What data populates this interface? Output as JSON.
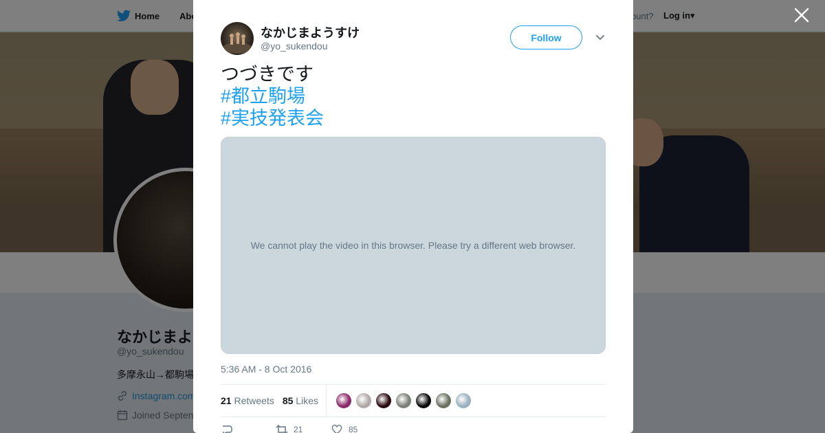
{
  "nav": {
    "home_label": "Home",
    "about_label": "Abo",
    "account_text": "ccount?",
    "login_label": "Log in"
  },
  "profile": {
    "name": "なかじまよ",
    "handle": "@yo_sukendou",
    "bio": "多摩永山→都駒場",
    "link_text": "Instagram.com",
    "joined_text": "Joined Septen"
  },
  "tweet": {
    "author_name": "なかじまようすけ",
    "author_handle": "@yo_sukendou",
    "follow_label": "Follow",
    "text": "つづきです",
    "hashtags": [
      "#都立駒場",
      "#実技発表会"
    ],
    "media_message": "We cannot play the video in this browser. Please try a different web browser.",
    "timestamp": "5:36 AM - 8 Oct 2016",
    "retweets_count": "21",
    "retweets_label": "Retweets",
    "likes_count": "85",
    "likes_label": "Likes",
    "action_retweet_count": "21",
    "action_like_count": "85"
  },
  "colors": {
    "accent": "#1da1f2",
    "text_primary": "#14171a",
    "text_secondary": "#657786",
    "media_placeholder": "#ccd6dd"
  },
  "likers": [
    {
      "color": "#8a2a6a"
    },
    {
      "color": "#b0a8a8"
    },
    {
      "color": "#2a0a10"
    },
    {
      "color": "#7a8078"
    },
    {
      "color": "#0a0a0a"
    },
    {
      "color": "#6a7060"
    },
    {
      "color": "#9ab0c0"
    }
  ],
  "icons": {
    "twitter": "twitter-bird-icon",
    "close": "close-icon",
    "caret": "chevron-down-icon",
    "link": "link-icon",
    "calendar": "calendar-icon",
    "reply": "reply-icon",
    "retweet": "retweet-icon",
    "like": "heart-icon"
  }
}
